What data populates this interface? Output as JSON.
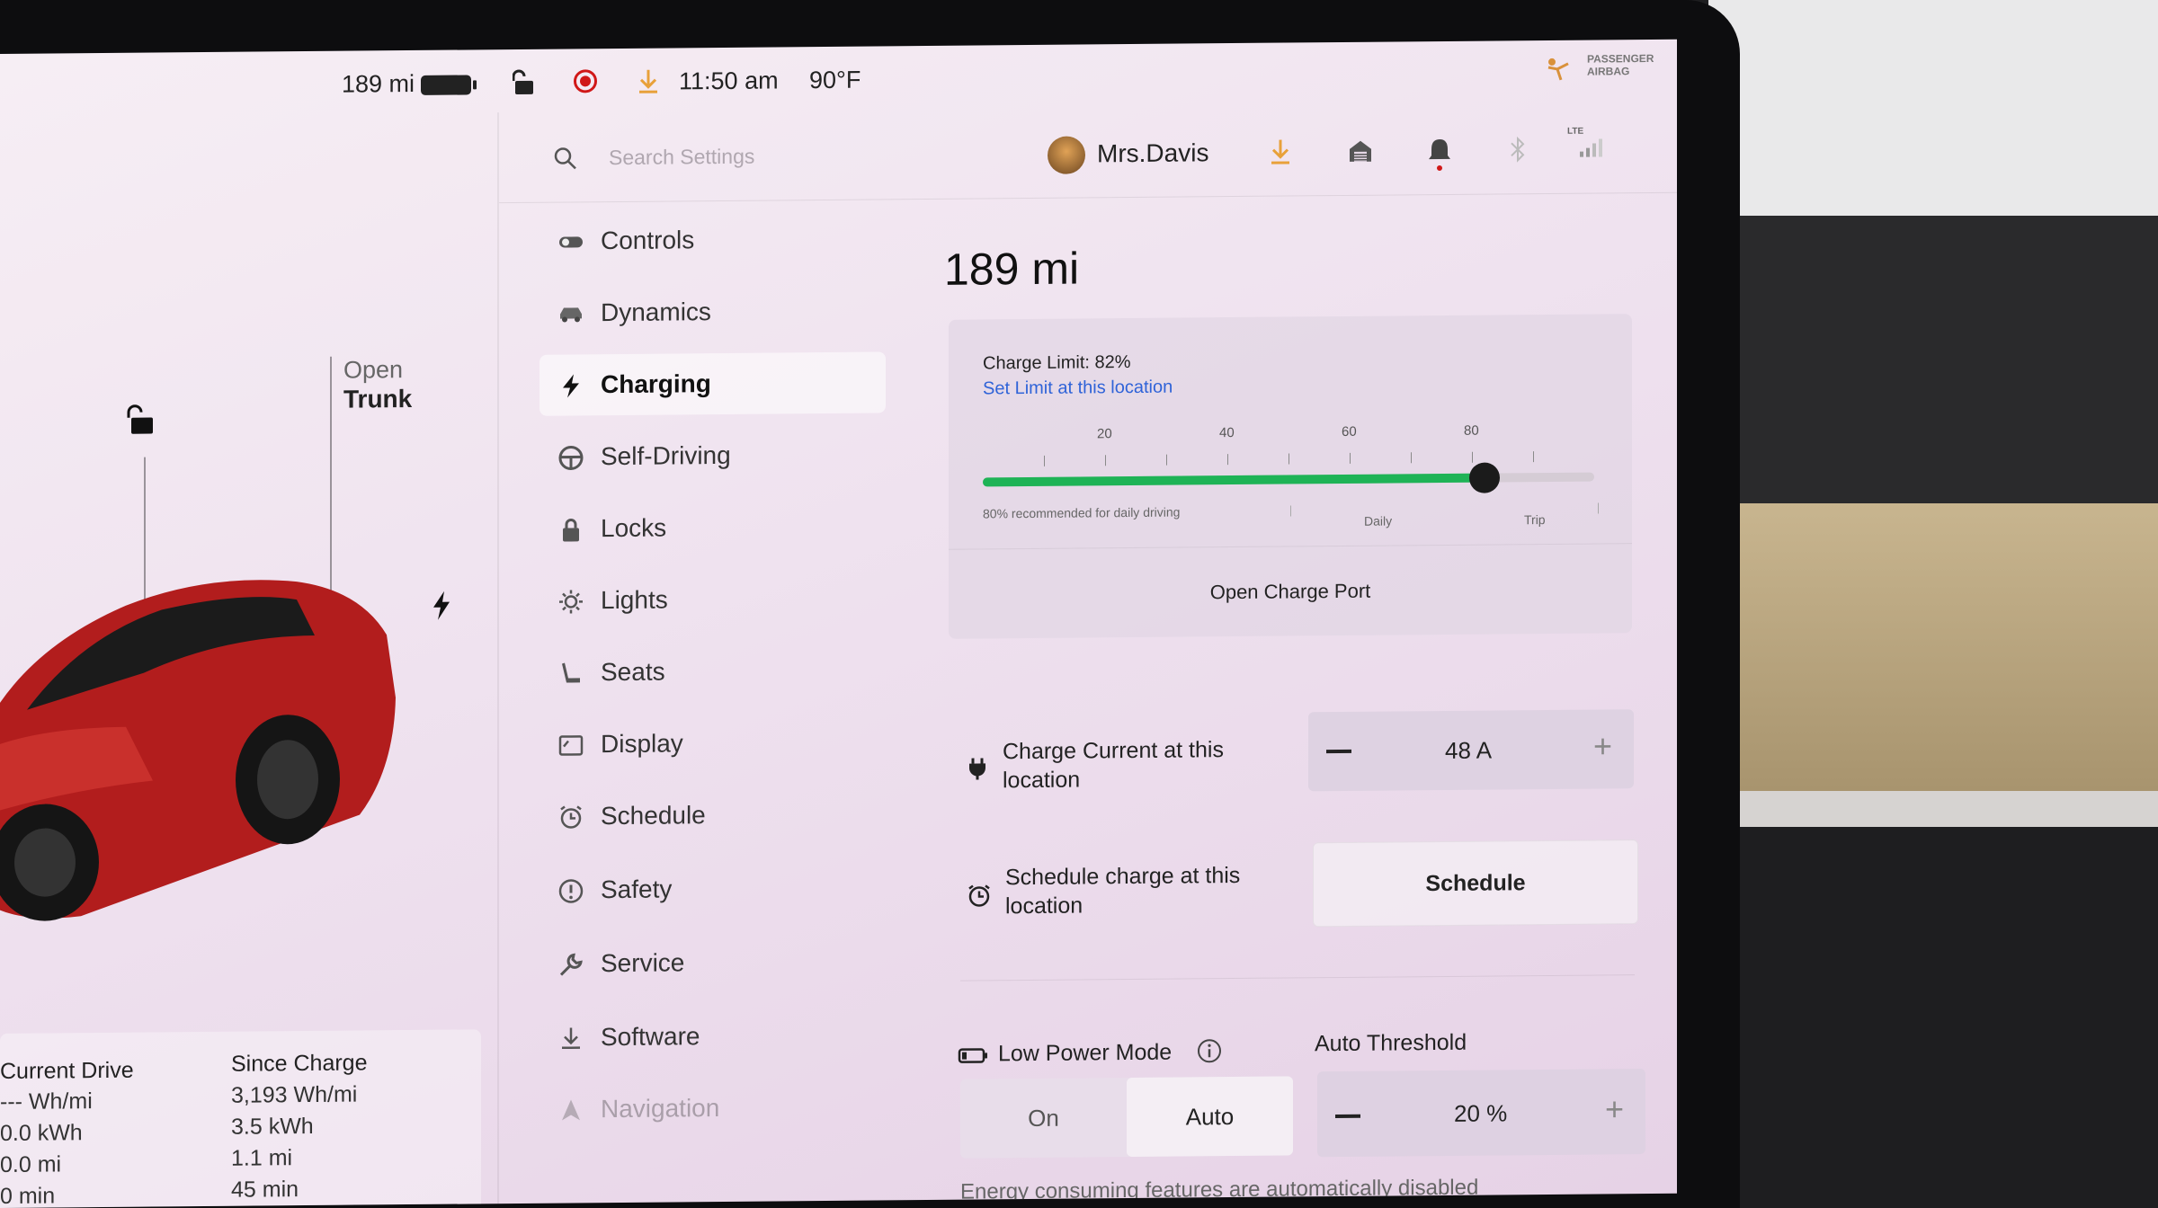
{
  "status_bar": {
    "range": "189 mi",
    "time": "11:50 am",
    "temperature": "90°F",
    "airbag_line1": "PASSENGER",
    "airbag_line2": "AIRBAG"
  },
  "car_panel": {
    "open_label": "Open",
    "trunk_label": "Trunk"
  },
  "trip_stats": {
    "current_drive": {
      "title": "Current Drive",
      "energy_rate": "--- Wh/mi",
      "energy": "0.0 kWh",
      "distance": "0.0 mi",
      "time": "0 min"
    },
    "since_charge": {
      "title": "Since Charge",
      "energy_rate": "3,193 Wh/mi",
      "energy": "3.5 kWh",
      "distance": "1.1 mi",
      "time": "45 min"
    }
  },
  "header": {
    "search_placeholder": "Search Settings",
    "user_name": "Mrs.Davis",
    "lte_label": "LTE"
  },
  "sidebar": {
    "items": [
      {
        "label": "Controls",
        "icon": "toggle-icon"
      },
      {
        "label": "Dynamics",
        "icon": "car-icon"
      },
      {
        "label": "Charging",
        "icon": "bolt-icon"
      },
      {
        "label": "Self-Driving",
        "icon": "steering-wheel-icon"
      },
      {
        "label": "Locks",
        "icon": "lock-icon"
      },
      {
        "label": "Lights",
        "icon": "sun-icon"
      },
      {
        "label": "Seats",
        "icon": "seat-icon"
      },
      {
        "label": "Display",
        "icon": "display-icon"
      },
      {
        "label": "Schedule",
        "icon": "alarm-clock-icon"
      },
      {
        "label": "Safety",
        "icon": "exclamation-circle-icon"
      },
      {
        "label": "Service",
        "icon": "wrench-icon"
      },
      {
        "label": "Software",
        "icon": "download-icon"
      },
      {
        "label": "Navigation",
        "icon": "navigation-arrow-icon"
      }
    ],
    "active": "Charging"
  },
  "charging": {
    "range": "189 mi",
    "charge_limit_text": "Charge Limit: 82%",
    "charge_limit_percent": 82,
    "set_limit_link": "Set Limit at this location",
    "tick_labels": [
      "20",
      "40",
      "60",
      "80"
    ],
    "recommendation": "80% recommended for daily driving",
    "daily_label": "Daily",
    "trip_label": "Trip",
    "open_charge_port": "Open Charge Port",
    "charge_current_label": "Charge Current at this location",
    "charge_current_value": "48  A",
    "schedule_label": "Schedule charge at this location",
    "schedule_button": "Schedule",
    "low_power_label": "Low Power Mode",
    "low_power_on": "On",
    "low_power_auto": "Auto",
    "low_power_selected": "Auto",
    "auto_threshold_label": "Auto Threshold",
    "auto_threshold_value": "20 %",
    "footer_text": "Energy consuming features are automatically disabled"
  },
  "colors": {
    "accent_green": "#1eb356",
    "link_blue": "#2f63d8",
    "download_orange": "#e8a13a",
    "record_red": "#d01818"
  }
}
